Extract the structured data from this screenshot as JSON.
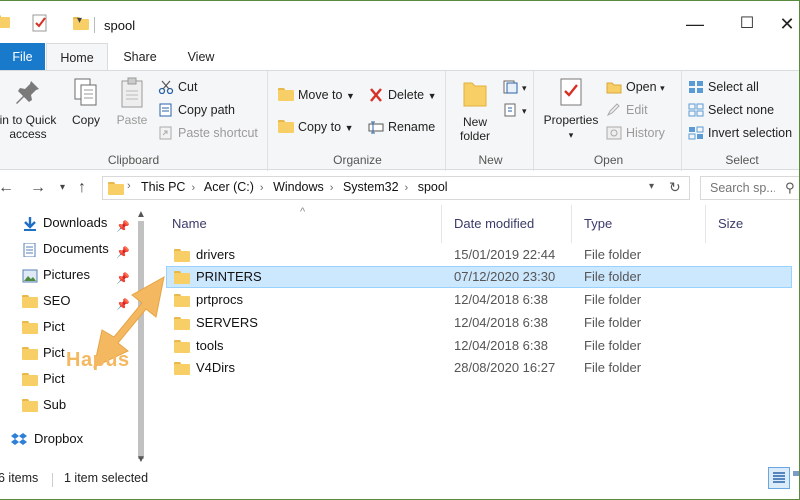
{
  "window": {
    "title": "spool",
    "minimize_glyph": "—",
    "maximize_glyph": "☐",
    "close_glyph": "✕"
  },
  "tabs": [
    {
      "label": "File"
    },
    {
      "label": "Home"
    },
    {
      "label": "Share"
    },
    {
      "label": "View"
    }
  ],
  "ribbon": {
    "clipboard": {
      "label": "Clipboard",
      "pin_label_1": "in to Quick",
      "pin_label_2": "access",
      "copy": "Copy",
      "paste": "Paste",
      "cut": "Cut",
      "copy_path": "Copy path",
      "paste_shortcut": "Paste shortcut"
    },
    "organize": {
      "label": "Organize",
      "move_to": "Move to",
      "copy_to": "Copy to",
      "delete": "Delete",
      "rename": "Rename"
    },
    "new": {
      "label": "New",
      "new_folder_1": "New",
      "new_folder_2": "folder"
    },
    "open": {
      "label": "Open",
      "properties": "Properties",
      "open": "Open",
      "edit": "Edit",
      "history": "History"
    },
    "select": {
      "label": "Select",
      "select_all": "Select all",
      "select_none": "Select none",
      "invert_selection": "Invert selection"
    }
  },
  "address": {
    "crumbs": [
      "This PC",
      "Acer (C:)",
      "Windows",
      "System32",
      "spool"
    ],
    "search_placeholder": "Search sp..."
  },
  "navpane": {
    "items": [
      {
        "label": "Downloads",
        "icon": "download-arrow-icon",
        "pinned": true
      },
      {
        "label": "Documents",
        "icon": "documents-icon",
        "pinned": true
      },
      {
        "label": "Pictures",
        "icon": "pictures-icon",
        "pinned": true
      },
      {
        "label": "SEO",
        "icon": "folder-icon",
        "pinned": true
      },
      {
        "label": "Pict",
        "icon": "folder-icon",
        "pinned": false
      },
      {
        "label": "Pict",
        "icon": "folder-icon",
        "pinned": false
      },
      {
        "label": "Pict",
        "icon": "folder-icon",
        "pinned": false
      },
      {
        "label": "Sub",
        "icon": "folder-icon",
        "pinned": false
      },
      {
        "label": "Dropbox",
        "icon": "dropbox-icon",
        "pinned": false
      }
    ]
  },
  "columns": {
    "name": "Name",
    "date": "Date modified",
    "type": "Type",
    "size": "Size"
  },
  "files": [
    {
      "name": "drivers",
      "date": "15/01/2019 22:44",
      "type": "File folder",
      "selected": false
    },
    {
      "name": "PRINTERS",
      "date": "07/12/2020 23:30",
      "type": "File folder",
      "selected": true
    },
    {
      "name": "prtprocs",
      "date": "12/04/2018 6:38",
      "type": "File folder",
      "selected": false
    },
    {
      "name": "SERVERS",
      "date": "12/04/2018 6:38",
      "type": "File folder",
      "selected": false
    },
    {
      "name": "tools",
      "date": "12/04/2018 6:38",
      "type": "File folder",
      "selected": false
    },
    {
      "name": "V4Dirs",
      "date": "28/08/2020 16:27",
      "type": "File folder",
      "selected": false
    }
  ],
  "annotation": {
    "label": "Hapus",
    "color": "#f4b860"
  },
  "status": {
    "items_count": "6 items",
    "selection": "1 item selected"
  },
  "colors": {
    "file_tab": "#1979ca",
    "selection_bg": "#cce8ff",
    "selection_border": "#99d1ff",
    "folder": "#f7cf66",
    "delete_red": "#d93025"
  }
}
